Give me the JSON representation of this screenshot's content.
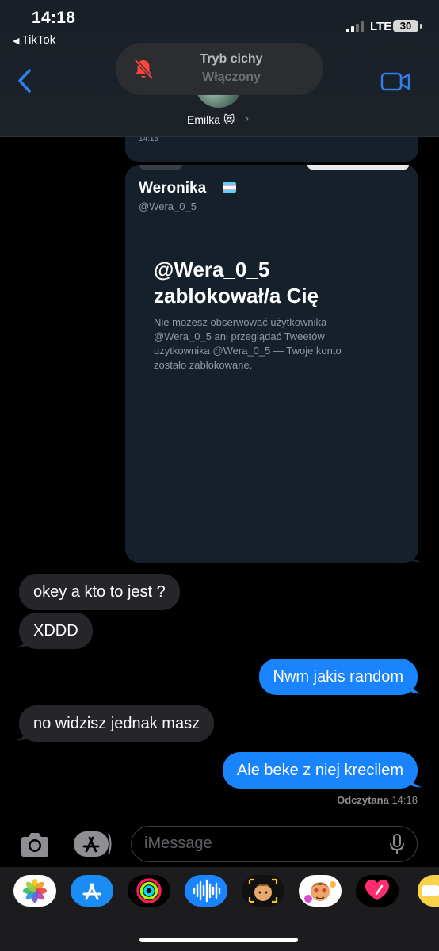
{
  "status_bar": {
    "time": "14:18",
    "back_app": "TikTok",
    "network": "LTE",
    "battery": "30"
  },
  "header": {
    "contact_name": "Emilka 😻",
    "chevron": "›"
  },
  "silent_banner": {
    "title": "Tryb cichy",
    "subtitle": "Włączony"
  },
  "chat": {
    "prev_time": "14:15",
    "tweet": {
      "name": "Weronika",
      "handle": "@Wera_0_5",
      "block_title": "@Wera_0_5 zablokował/a Cię",
      "block_body": "Nie możesz obserwować użytkownika @Wera_0_5 ani przeglądać Tweetów użytkownika @Wera_0_5 — Twoje konto zostało zablokowane."
    },
    "messages": [
      {
        "side": "received",
        "text": "okey a kto to jest ?"
      },
      {
        "side": "received",
        "text": "XDDD"
      },
      {
        "side": "sent",
        "text": "Nwm jakis random"
      },
      {
        "side": "received",
        "text": "no widzisz jednak masz"
      },
      {
        "side": "sent",
        "text": "Ale beke z niej krecilem"
      }
    ],
    "read_label": "Odczytana",
    "read_time": "14:18"
  },
  "composer": {
    "placeholder": "iMessage"
  },
  "drawer_apps": [
    "photos-icon",
    "app-store-icon",
    "activity-icon",
    "audio-message-icon",
    "memoji-icon",
    "memoji-stickers-icon",
    "digital-touch-icon",
    "more-apps-icon"
  ],
  "colors": {
    "sent_bubble": "#1a84ff",
    "received_bubble": "#26252a",
    "tweet_card": "#15202b",
    "accent": "#2f7ff0"
  }
}
